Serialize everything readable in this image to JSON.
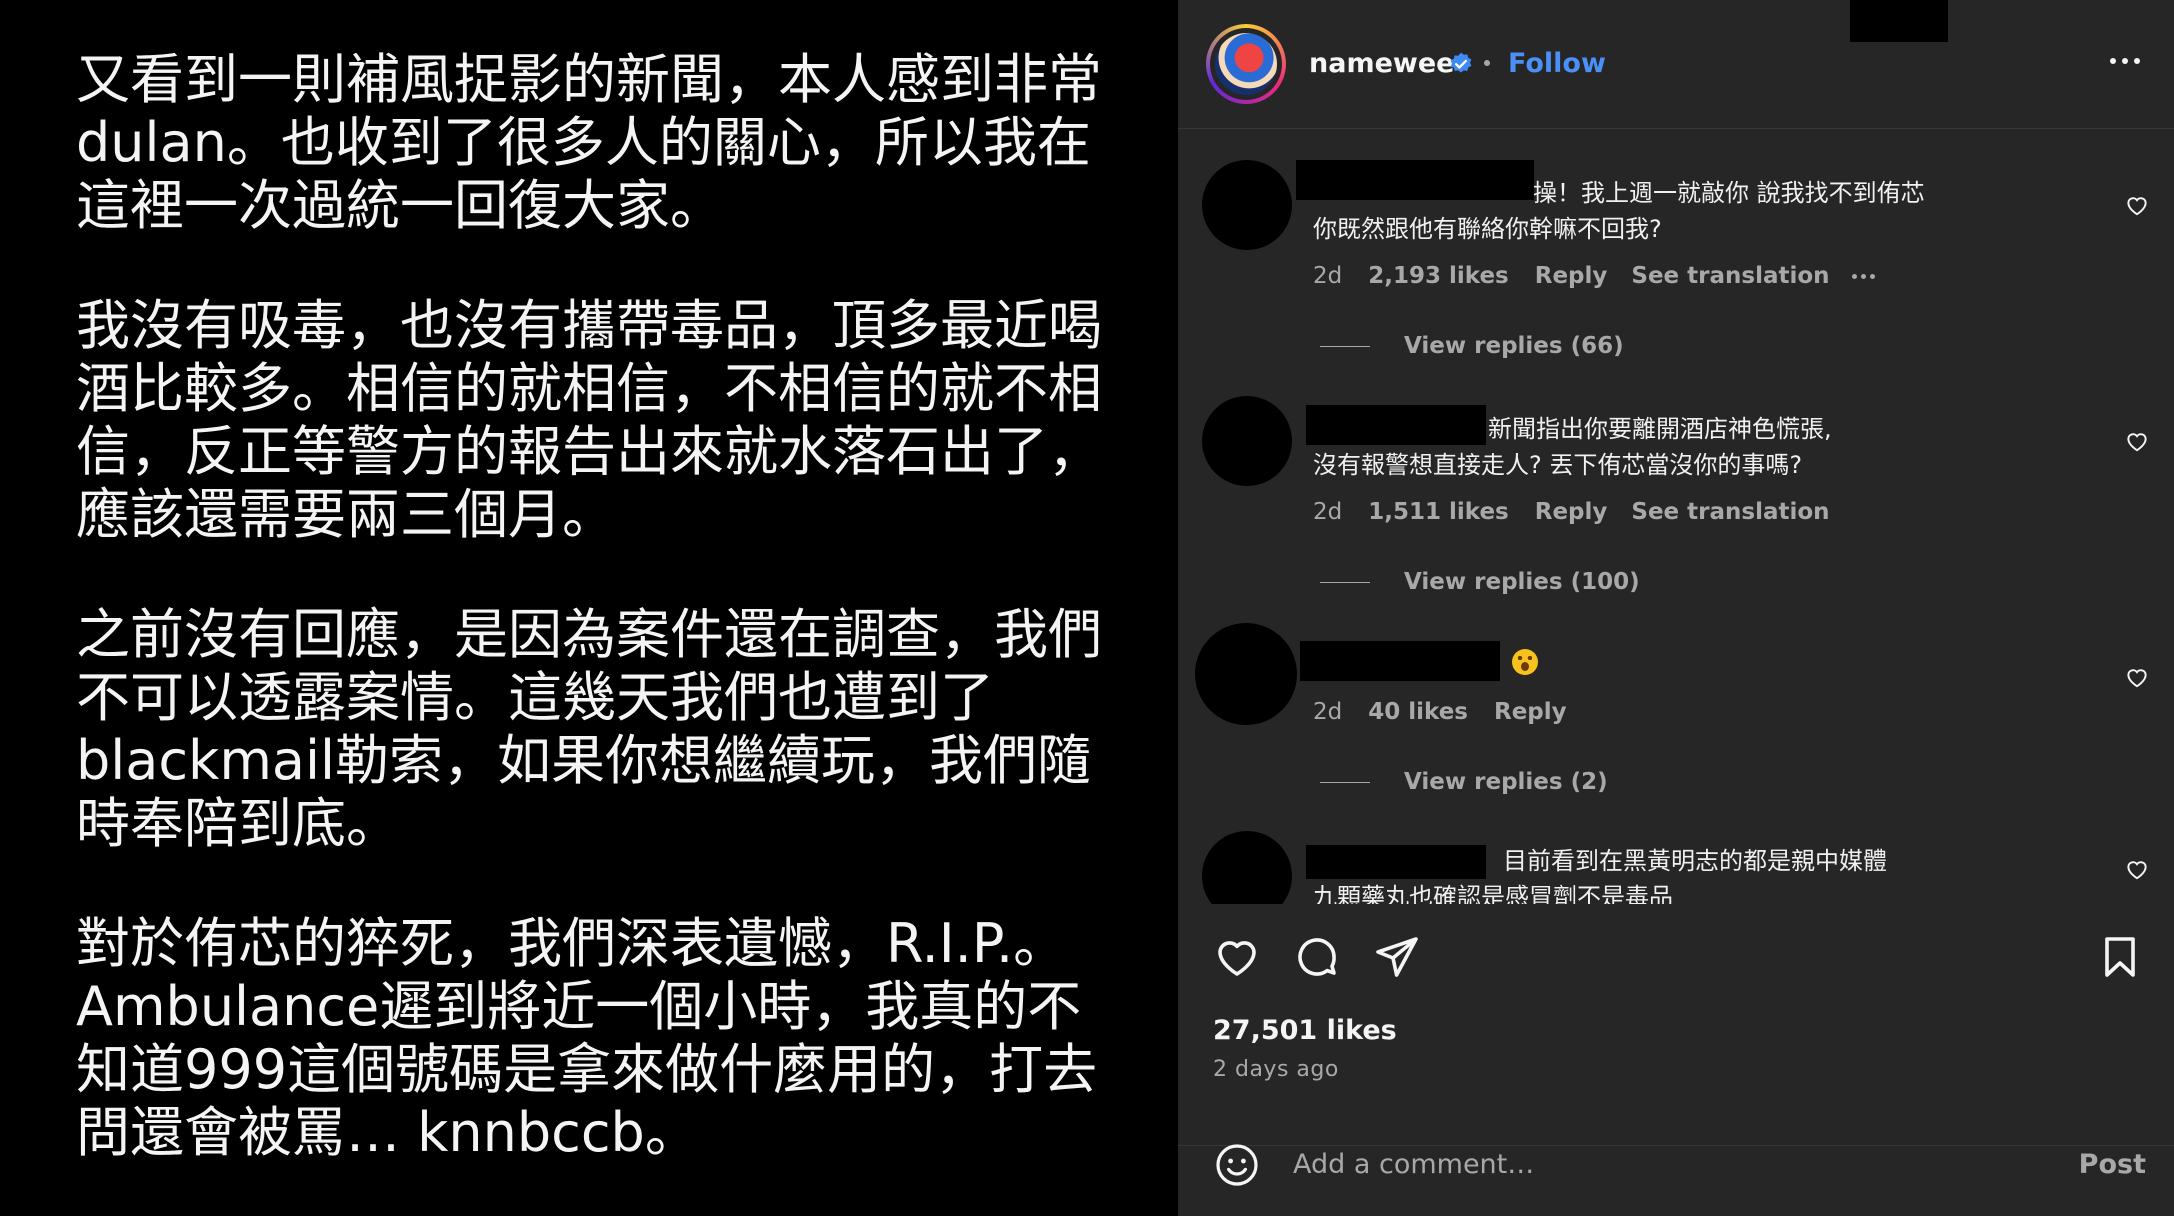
{
  "post_text": [
    [
      "又看到一則補風捉影的新聞，本人感到非常",
      "dulan。也收到了很多人的關心，所以我在",
      "這裡一次過統一回復大家。"
    ],
    [
      "我沒有吸毒，也沒有攜帶毒品，頂多最近喝",
      "酒比較多。相信的就相信，不相信的就不相",
      "信，反正等警方的報告出來就水落石出了，",
      "應該還需要兩三個月。"
    ],
    [
      "之前沒有回應，是因為案件還在調查，我們",
      "不可以透露案情。這幾天我們也遭到了",
      "blackmail勒索，如果你想繼續玩，我們隨",
      "時奉陪到底。"
    ],
    [
      "對於侑芯的猝死，我們深表遺憾，R.I.P.。",
      "Ambulance遲到將近一個小時，我真的不",
      "知道999這個號碼是拿來做什麼用的，打去",
      "問還會被罵… knnbccb。"
    ]
  ],
  "header": {
    "username": "namewee",
    "follow_label": "Follow"
  },
  "comments": [
    {
      "text_lines": [
        "操！我上週一就敲你 說我找不到侑芯",
        "你既然跟他有聯絡你幹嘛不回我?"
      ],
      "time": "2d",
      "likes": "2,193 likes",
      "reply": "Reply",
      "translation": "See translation",
      "view_replies": "View replies (66)"
    },
    {
      "text_lines": [
        "新聞指出你要離開酒店神色慌張,",
        "沒有報警想直接走人? 丟下侑芯當沒你的事嗎?"
      ],
      "time": "2d",
      "likes": "1,511 likes",
      "reply": "Reply",
      "translation": "See translation",
      "view_replies": "View replies (100)"
    },
    {
      "emoji": "astonished-face",
      "time": "2d",
      "likes": "40 likes",
      "reply": "Reply",
      "view_replies": "View replies (2)"
    },
    {
      "text_lines": [
        "目前看到在黑黃明志的都是親中媒體",
        "九顆藥丸也確認是感冒劑不是毒品"
      ]
    }
  ],
  "post_meta": {
    "likes": "27,501 likes",
    "time_ago": "2 days ago"
  },
  "comment_box": {
    "placeholder": "Add a comment…",
    "post_label": "Post"
  },
  "colors": {
    "panel_bg": "#262626",
    "follow_blue": "#4a90f7",
    "muted": "#a8a8a8"
  }
}
